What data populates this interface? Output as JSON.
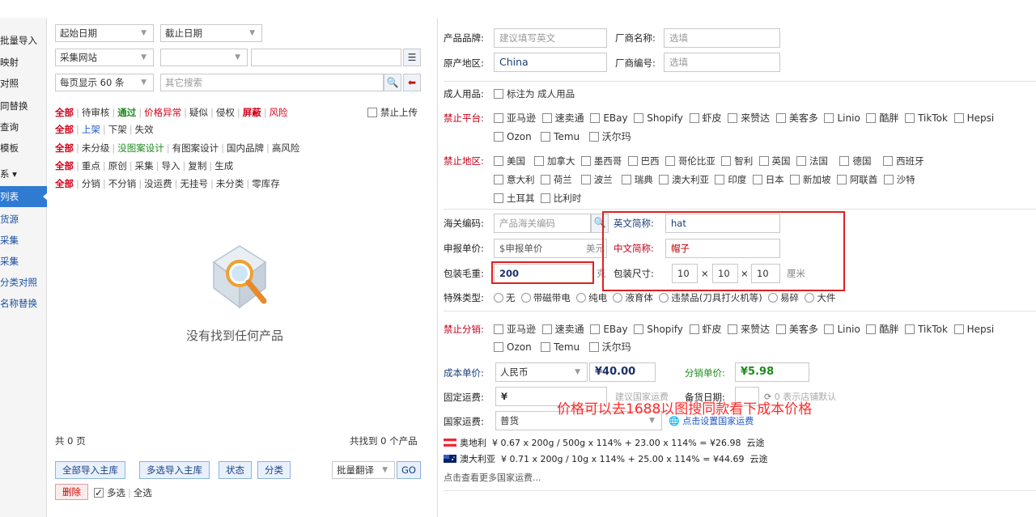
{
  "sidebar": {
    "items": [
      {
        "label": "批量导入"
      },
      {
        "label": "映射"
      },
      {
        "label": "对照"
      },
      {
        "label": "同替换"
      },
      {
        "label": "查询"
      },
      {
        "label": "模板"
      },
      {
        "label": "系 ▾"
      },
      {
        "label": "列表"
      },
      {
        "label": "货源"
      },
      {
        "label": "采集"
      },
      {
        "label": "采集"
      },
      {
        "label": "分类对照"
      },
      {
        "label": "名称替换"
      }
    ]
  },
  "filters": {
    "start_date": "起始日期",
    "end_date": "截止日期",
    "site": "采集网站",
    "page_size": "每页显示 60 条",
    "search_placeholder": "其它搜索",
    "ban_upload": "禁止上传"
  },
  "filter_rows": {
    "row1": [
      "全部",
      "待审核",
      "通过",
      "价格异常",
      "疑似",
      "侵权",
      "屏蔽",
      "风险"
    ],
    "row2": [
      "全部",
      "上架",
      "下架",
      "失效"
    ],
    "row3": [
      "全部",
      "未分级",
      "没图案设计",
      "有图案设计",
      "国内品牌",
      "高风险"
    ],
    "row4": [
      "全部",
      "重点",
      "原创",
      "采集",
      "导入",
      "复制",
      "生成"
    ],
    "row5": [
      "全部",
      "分销",
      "不分销",
      "没运费",
      "无挂号",
      "未分类",
      "零库存"
    ]
  },
  "empty_text": "没有找到任何产品",
  "pager": {
    "pages": "共 0 页",
    "found": "共找到 0 个产品"
  },
  "actions": {
    "import_all": "全部导入主库",
    "import_selected": "多选导入主库",
    "status": "状态",
    "category": "分类",
    "batch_translate": "批量翻译",
    "go": "GO",
    "delete": "删除",
    "select_multi": "多选",
    "select_all": "全选"
  },
  "form": {
    "brand_label": "产品品牌:",
    "brand_placeholder": "建议填写英文",
    "maker_label": "厂商名称:",
    "maker_placeholder": "选填",
    "origin_label": "原产地区:",
    "origin_value": "China",
    "maker_code_label": "厂商编号:",
    "maker_code_placeholder": "选填",
    "adult_label": "成人用品:",
    "adult_option": "标注为 成人用品",
    "ban_platform_label": "禁止平台:",
    "platforms_row1": [
      "亚马逊",
      "速卖通",
      "EBay",
      "Shopify",
      "虾皮",
      "来赞达",
      "美客多",
      "Linio",
      "酷胖",
      "TikTok",
      "Hepsi"
    ],
    "platforms_row2": [
      "Ozon",
      "Temu",
      "沃尔玛"
    ],
    "ban_region_label": "禁止地区:",
    "regions_row1": [
      "美国",
      "加拿大",
      "墨西哥",
      "巴西",
      "哥伦比亚",
      "智利",
      "英国",
      "法国",
      "德国",
      "西班牙"
    ],
    "regions_row2": [
      "意大利",
      "荷兰",
      "波兰",
      "瑞典",
      "澳大利亚",
      "印度",
      "日本",
      "新加坡",
      "阿联酋",
      "沙特"
    ],
    "regions_row3": [
      "土耳其",
      "比利时"
    ],
    "hs_label": "海关编码:",
    "hs_placeholder": "产品海关编码",
    "en_short_label": "英文简称:",
    "en_short_value": "hat",
    "declare_label": "申报单价:",
    "declare_placeholder": "$申报单价",
    "declare_unit": "美元",
    "cn_short_label": "中文简称:",
    "cn_short_value": "帽子",
    "weight_label": "包装毛重:",
    "weight_value": "200",
    "weight_unit": "克",
    "size_label": "包装尺寸:",
    "size_l": "10",
    "size_w": "10",
    "size_h": "10",
    "size_unit": "厘米",
    "special_label": "特殊类型:",
    "special_options": [
      "无",
      "带磁带电",
      "纯电",
      "液育体",
      "违禁品(刀具打火机等)",
      "易碎",
      "大件"
    ],
    "ban_dist_label": "禁止分销:",
    "cost_label": "成本单价:",
    "currency": "人民币",
    "cost_value": "¥40.00",
    "dist_price_label": "分销单价:",
    "dist_price_value": "¥5.98",
    "fixed_freight_label": "固定运费:",
    "fixed_freight_value": "¥",
    "country_freight_hint": "建议国家运费",
    "stock_date_label": "备货日期:",
    "stock_hint": "0 表示店铺默认",
    "country_freight_label": "国家运费:",
    "shipping_method": "普货",
    "set_freight_link": "点击设置国家运费",
    "freight_rows": [
      {
        "country": "奥地利",
        "formula": "¥ 0.67 x 200g / 500g x 114% + 23.00 x 114% = ¥26.98",
        "carrier": "云途"
      },
      {
        "country": "澳大利亚",
        "formula": "¥ 0.71 x 200g / 10g x 114% + 25.00 x 114% = ¥44.69",
        "carrier": "云途"
      }
    ],
    "more_link": "点击查看更多国家运费..."
  },
  "annotation_text": "价格可以去1688以图搜同款看下成本价格",
  "colors": {
    "accent": "#2f7bd2",
    "annotation": "#e02020"
  }
}
